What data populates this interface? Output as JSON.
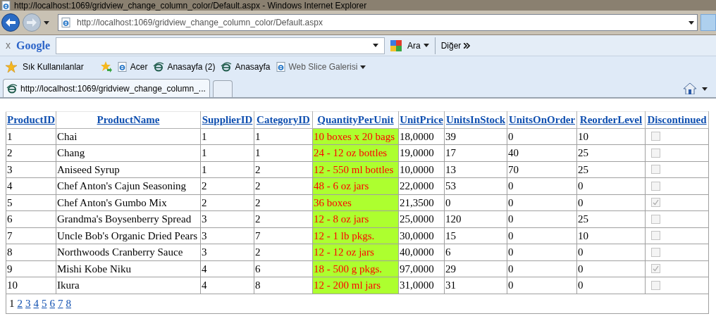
{
  "window": {
    "title": "http://localhost:1069/gridview_change_column_color/Default.aspx - Windows Internet Explorer"
  },
  "address_bar": {
    "url": "http://localhost:1069/gridview_change_column_color/Default.aspx"
  },
  "google_toolbar": {
    "logo": "Google",
    "close": "x",
    "search_button": "Ara",
    "more": "Diğer"
  },
  "favorites_bar": {
    "favorites": "Sık Kullanılanlar",
    "links": [
      {
        "label": "Acer",
        "kind": "page"
      },
      {
        "label": "Anasayfa (2)",
        "kind": "ie"
      },
      {
        "label": "Anasayfa",
        "kind": "ie"
      },
      {
        "label": "Web Slice Galerisi",
        "kind": "slice"
      }
    ]
  },
  "tabs": [
    {
      "label": "http://localhost:1069/gridview_change_column_...",
      "selected": true
    }
  ],
  "table": {
    "columns": [
      "ProductID",
      "ProductName",
      "SupplierID",
      "CategoryID",
      "QuantityPerUnit",
      "UnitPrice",
      "UnitsInStock",
      "UnitsOnOrder",
      "ReorderLevel",
      "Discontinued"
    ],
    "rows": [
      {
        "cells": [
          "1",
          "Chai",
          "1",
          "1",
          "10 boxes x 20 bags",
          "18,0000",
          "39",
          "0",
          "10"
        ],
        "discontinued": false
      },
      {
        "cells": [
          "2",
          "Chang",
          "1",
          "1",
          "24 - 12 oz bottles",
          "19,0000",
          "17",
          "40",
          "25"
        ],
        "discontinued": false
      },
      {
        "cells": [
          "3",
          "Aniseed Syrup",
          "1",
          "2",
          "12 - 550 ml bottles",
          "10,0000",
          "13",
          "70",
          "25"
        ],
        "discontinued": false
      },
      {
        "cells": [
          "4",
          "Chef Anton's Cajun Seasoning",
          "2",
          "2",
          "48 - 6 oz jars",
          "22,0000",
          "53",
          "0",
          "0"
        ],
        "discontinued": false
      },
      {
        "cells": [
          "5",
          "Chef Anton's Gumbo Mix",
          "2",
          "2",
          "36 boxes",
          "21,3500",
          "0",
          "0",
          "0"
        ],
        "discontinued": true
      },
      {
        "cells": [
          "6",
          "Grandma's Boysenberry Spread",
          "3",
          "2",
          "12 - 8 oz jars",
          "25,0000",
          "120",
          "0",
          "25"
        ],
        "discontinued": false
      },
      {
        "cells": [
          "7",
          "Uncle Bob's Organic Dried Pears",
          "3",
          "7",
          "12 - 1 lb pkgs.",
          "30,0000",
          "15",
          "0",
          "10"
        ],
        "discontinued": false
      },
      {
        "cells": [
          "8",
          "Northwoods Cranberry Sauce",
          "3",
          "2",
          "12 - 12 oz jars",
          "40,0000",
          "6",
          "0",
          "0"
        ],
        "discontinued": false
      },
      {
        "cells": [
          "9",
          "Mishi Kobe Niku",
          "4",
          "6",
          "18 - 500 g pkgs.",
          "97,0000",
          "29",
          "0",
          "0"
        ],
        "discontinued": true
      },
      {
        "cells": [
          "10",
          "Ikura",
          "4",
          "8",
          "12 - 200 ml jars",
          "31,0000",
          "31",
          "0",
          "0"
        ],
        "discontinued": false
      }
    ],
    "pager": [
      {
        "label": "1",
        "selected": true
      },
      {
        "label": "2",
        "selected": false
      },
      {
        "label": "3",
        "selected": false
      },
      {
        "label": "4",
        "selected": false
      },
      {
        "label": "5",
        "selected": false
      },
      {
        "label": "6",
        "selected": false
      },
      {
        "label": "7",
        "selected": false
      },
      {
        "label": "8",
        "selected": false
      }
    ]
  }
}
